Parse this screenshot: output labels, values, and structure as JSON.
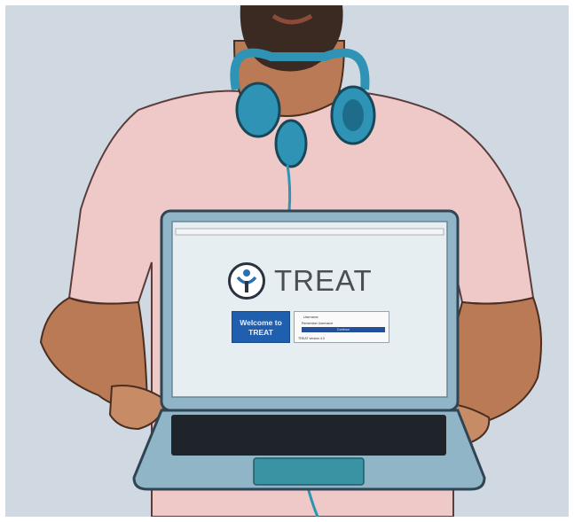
{
  "screen": {
    "logo_text": "TREAT",
    "welcome_line1": "Welcome to",
    "welcome_line2": "TREAT",
    "username_label": "Username",
    "remember_label": "Remember Username",
    "login_button": "Continue",
    "footer_note": "TREAT version 4.0"
  },
  "colors": {
    "background": "#d0d9e2",
    "shirt": "#eec9c7",
    "skin": "#b97a55",
    "headphones": "#2f93b5",
    "laptop_body": "#8fb5c7",
    "keyboard": "#1e242a",
    "trackpad": "#3a93a3",
    "accent_blue": "#1f5fae"
  }
}
